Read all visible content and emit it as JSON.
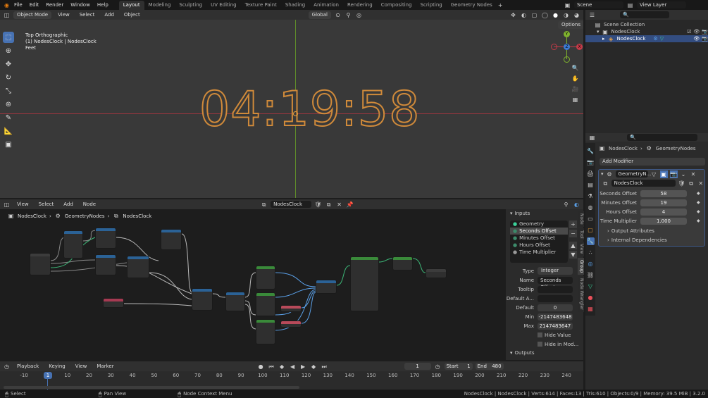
{
  "menu": [
    "File",
    "Edit",
    "Render",
    "Window",
    "Help"
  ],
  "workspaces": [
    "Layout",
    "Modeling",
    "Sculpting",
    "UV Editing",
    "Texture Paint",
    "Shading",
    "Animation",
    "Rendering",
    "Compositing",
    "Scripting",
    "Geometry Nodes"
  ],
  "scene_name": "Scene",
  "view_layer": "View Layer",
  "viewport": {
    "mode": "Object Mode",
    "menu": [
      "View",
      "Select",
      "Add",
      "Object"
    ],
    "transform": "Global",
    "options": "Options",
    "info_line1": "Top Orthographic",
    "info_line2": "(1) NodesClock | NodesClock",
    "info_line3": "Feet",
    "clock_text": "04:19:58",
    "gizmo": {
      "x": "X",
      "y": "Y",
      "z": "Z"
    }
  },
  "outliner": {
    "collection": "Scene Collection",
    "items": [
      "NodesClock",
      "NodesClock"
    ]
  },
  "properties": {
    "breadcrumb": [
      "NodesClock",
      "GeometryNodes"
    ],
    "add_modifier": "Add Modifier",
    "modifier_name": "GeometryN...",
    "node_group": "NodesClock",
    "rows": [
      {
        "label": "Seconds Offset",
        "value": "58"
      },
      {
        "label": "Minutes Offset",
        "value": "19"
      },
      {
        "label": "Hours Offset",
        "value": "4"
      },
      {
        "label": "Time Multiplier",
        "value": "1.000"
      }
    ],
    "sections": [
      "Output Attributes",
      "Internal Dependencies"
    ]
  },
  "node_editor": {
    "menu": [
      "View",
      "Select",
      "Add",
      "Node"
    ],
    "tree_name": "NodesClock",
    "breadcrumb": [
      "NodesClock",
      "GeometryNodes",
      "NodesClock"
    ]
  },
  "group_panel": {
    "inputs_title": "Inputs",
    "inputs": [
      "Geometry",
      "Seconds Offset",
      "Minutes Offset",
      "Hours Offset",
      "Time Multiplier"
    ],
    "type_label": "Type",
    "type_value": "Integer",
    "name_label": "Name",
    "name_value": "Seconds Offset",
    "tooltip_label": "Tooltip",
    "default_a_label": "Default A...",
    "default_label": "Default",
    "default_value": "0",
    "min_label": "Min",
    "min_value": "-2147483648",
    "max_label": "Max",
    "max_value": "2147483647",
    "hide_value": "Hide Value",
    "hide_in_mod": "Hide in Mod...",
    "outputs_title": "Outputs",
    "side_tabs": [
      "Node",
      "Tool",
      "View",
      "Group",
      "Node Wrangler"
    ]
  },
  "timeline": {
    "menu": [
      "Playback",
      "Keying",
      "View",
      "Marker"
    ],
    "current_frame": "1",
    "start_label": "Start",
    "start_value": "1",
    "end_label": "End",
    "end_value": "480",
    "ticks": [
      "-10",
      "1",
      "10",
      "20",
      "30",
      "40",
      "50",
      "60",
      "70",
      "80",
      "90",
      "100",
      "110",
      "120",
      "130",
      "140",
      "150",
      "160",
      "170",
      "180",
      "190",
      "200",
      "210",
      "220",
      "230",
      "240"
    ]
  },
  "statusbar": {
    "select": "Select",
    "pan": "Pan View",
    "context": "Node Context Menu",
    "stats": "NodesClock | NodesClock | Verts:614 | Faces:13 | Tris:610 | Objects:0/9 | Memory: 39.5 MiB | 3.2.0"
  },
  "colors": {
    "accent": "#4772b3",
    "clock_outline": "#d08a3a",
    "x_axis": "#c33b48",
    "y_axis": "#7fb22e",
    "z_axis": "#3c7bd6"
  }
}
